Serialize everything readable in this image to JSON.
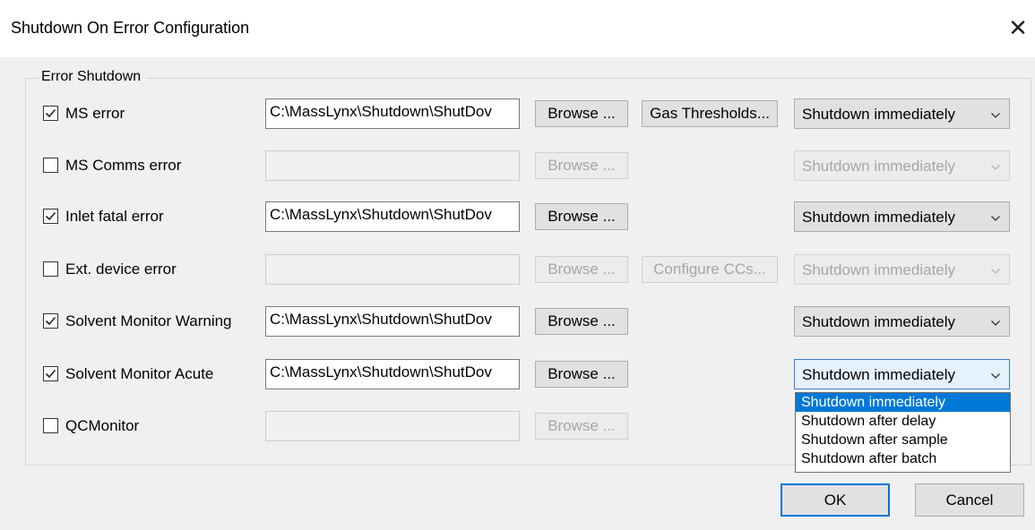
{
  "dialog": {
    "title": "Shutdown On Error Configuration",
    "close_glyph": "✕",
    "group_label": "Error Shutdown",
    "ok_label": "OK",
    "cancel_label": "Cancel"
  },
  "rows": [
    {
      "label": "MS error",
      "checked": true,
      "enabled": true,
      "path": "C:\\MassLynx\\Shutdown\\ShutDov",
      "browse_label": "Browse ...",
      "extra_button": "Gas Thresholds...",
      "extra_enabled": true,
      "action": "Shutdown immediately"
    },
    {
      "label": "MS Comms error",
      "checked": false,
      "enabled": false,
      "path": "",
      "browse_label": "Browse ...",
      "action": "Shutdown immediately"
    },
    {
      "label": "Inlet fatal error",
      "checked": true,
      "enabled": true,
      "path": "C:\\MassLynx\\Shutdown\\ShutDov",
      "browse_label": "Browse ...",
      "action": "Shutdown immediately"
    },
    {
      "label": "Ext. device error",
      "checked": false,
      "enabled": false,
      "path": "",
      "browse_label": "Browse ...",
      "extra_button": "Configure CCs...",
      "extra_enabled": false,
      "action": "Shutdown immediately"
    },
    {
      "label": "Solvent Monitor Warning",
      "checked": true,
      "enabled": true,
      "path": "C:\\MassLynx\\Shutdown\\ShutDov",
      "browse_label": "Browse ...",
      "action": "Shutdown immediately"
    },
    {
      "label": "Solvent Monitor Acute",
      "checked": true,
      "enabled": true,
      "path": "C:\\MassLynx\\Shutdown\\ShutDov",
      "browse_label": "Browse ...",
      "action": "Shutdown immediately",
      "dropdown_open": true
    },
    {
      "label": "QCMonitor",
      "checked": false,
      "enabled": false,
      "path": "",
      "browse_label": "Browse ..."
    }
  ],
  "dropdown_options": [
    "Shutdown immediately",
    "Shutdown after delay",
    "Shutdown after sample",
    "Shutdown after batch"
  ],
  "dropdown_selected_index": 0,
  "icons": {
    "checkbox_checked": "checkmark-icon",
    "combo_arrow": "chevron-down-icon",
    "close": "close-icon"
  },
  "colors": {
    "selection": "#0078d7",
    "focus_border": "#3b7ad4"
  }
}
